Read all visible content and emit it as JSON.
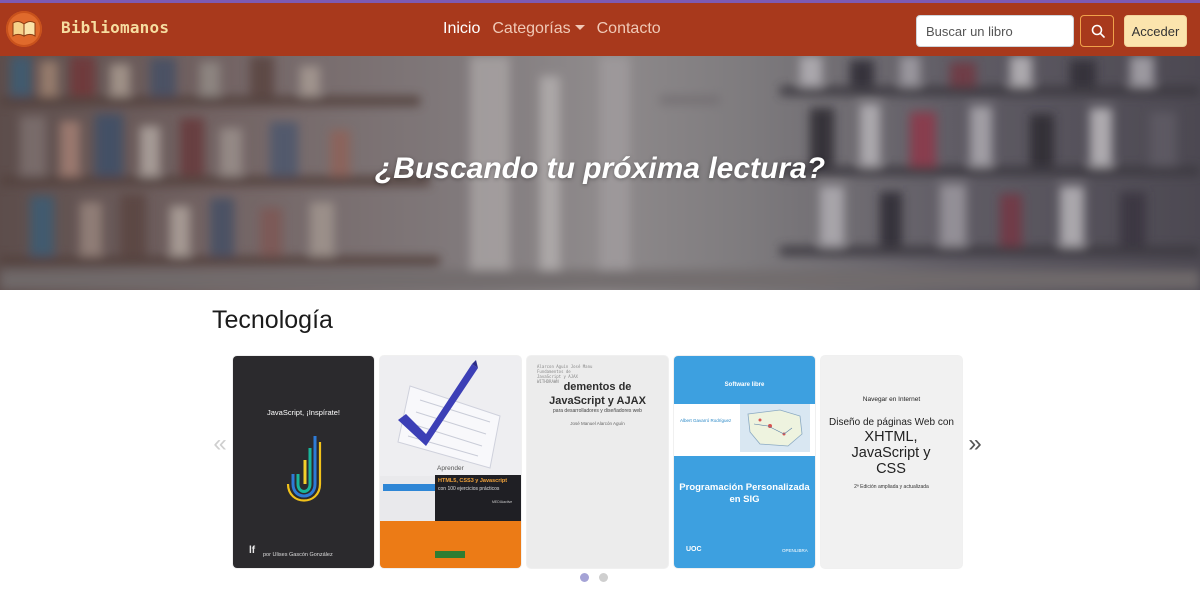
{
  "navbar": {
    "brand": "Bibliomanos",
    "links": [
      {
        "label": "Inicio"
      },
      {
        "label": "Categorías"
      },
      {
        "label": "Contacto"
      }
    ],
    "search": {
      "placeholder": "Buscar un libro"
    },
    "login_label": "Acceder",
    "colors": {
      "background": "#a8391c",
      "top_border": "#7d5ab3",
      "brand_text": "#f6dda0",
      "login_bg": "#fbe4ad"
    }
  },
  "hero": {
    "title": "¿Buscando tu próxima lectura?"
  },
  "section": {
    "title": "Tecnología",
    "prev_label": "«",
    "next_label": "»",
    "books": [
      {
        "cover_text": "JavaScript, ¡Inspírate!",
        "author": "por Ulises Gascón González",
        "mini_logo": "lf"
      },
      {
        "tag": "Aprender",
        "title_line": "HTML5, CSS3 y Javascript",
        "subtitle": "con 100 ejercicios prácticos",
        "publisher": "MEDIAactive"
      },
      {
        "header": "dementos de",
        "title": "JavaScript y AJAX",
        "subtitle": "para desarrolladores y diseñadores web",
        "author": "José Manuel Alarcón Aguín"
      },
      {
        "tag": "Software libre",
        "author": "Albert Gavarró Rodríguez",
        "title": "Programación Personalizada en SIG",
        "publisher_left": "UOC",
        "publisher_right": "OPENLIBRA"
      },
      {
        "series": "Navegar en Internet",
        "title_intro": "Diseño de páginas Web con",
        "title_main": "XHTML, JavaScript y CSS",
        "edition": "2ª Edición ampliada y actualizada"
      }
    ],
    "pagination": {
      "pages": 2,
      "current": 1
    }
  }
}
